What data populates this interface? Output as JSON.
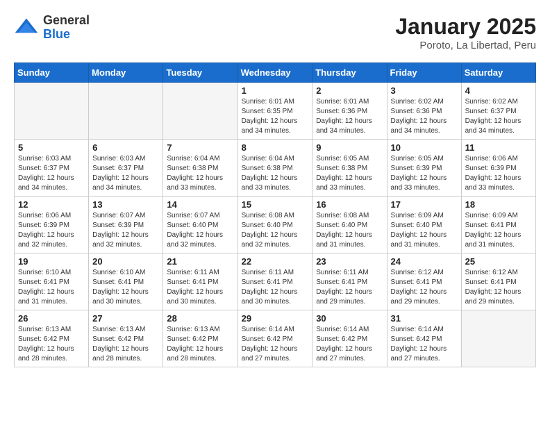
{
  "header": {
    "logo": {
      "general": "General",
      "blue": "Blue"
    },
    "title": "January 2025",
    "location": "Poroto, La Libertad, Peru"
  },
  "calendar": {
    "weekdays": [
      "Sunday",
      "Monday",
      "Tuesday",
      "Wednesday",
      "Thursday",
      "Friday",
      "Saturday"
    ],
    "weeks": [
      [
        {
          "day": "",
          "info": ""
        },
        {
          "day": "",
          "info": ""
        },
        {
          "day": "",
          "info": ""
        },
        {
          "day": "1",
          "info": "Sunrise: 6:01 AM\nSunset: 6:35 PM\nDaylight: 12 hours\nand 34 minutes."
        },
        {
          "day": "2",
          "info": "Sunrise: 6:01 AM\nSunset: 6:36 PM\nDaylight: 12 hours\nand 34 minutes."
        },
        {
          "day": "3",
          "info": "Sunrise: 6:02 AM\nSunset: 6:36 PM\nDaylight: 12 hours\nand 34 minutes."
        },
        {
          "day": "4",
          "info": "Sunrise: 6:02 AM\nSunset: 6:37 PM\nDaylight: 12 hours\nand 34 minutes."
        }
      ],
      [
        {
          "day": "5",
          "info": "Sunrise: 6:03 AM\nSunset: 6:37 PM\nDaylight: 12 hours\nand 34 minutes."
        },
        {
          "day": "6",
          "info": "Sunrise: 6:03 AM\nSunset: 6:37 PM\nDaylight: 12 hours\nand 34 minutes."
        },
        {
          "day": "7",
          "info": "Sunrise: 6:04 AM\nSunset: 6:38 PM\nDaylight: 12 hours\nand 33 minutes."
        },
        {
          "day": "8",
          "info": "Sunrise: 6:04 AM\nSunset: 6:38 PM\nDaylight: 12 hours\nand 33 minutes."
        },
        {
          "day": "9",
          "info": "Sunrise: 6:05 AM\nSunset: 6:38 PM\nDaylight: 12 hours\nand 33 minutes."
        },
        {
          "day": "10",
          "info": "Sunrise: 6:05 AM\nSunset: 6:39 PM\nDaylight: 12 hours\nand 33 minutes."
        },
        {
          "day": "11",
          "info": "Sunrise: 6:06 AM\nSunset: 6:39 PM\nDaylight: 12 hours\nand 33 minutes."
        }
      ],
      [
        {
          "day": "12",
          "info": "Sunrise: 6:06 AM\nSunset: 6:39 PM\nDaylight: 12 hours\nand 32 minutes."
        },
        {
          "day": "13",
          "info": "Sunrise: 6:07 AM\nSunset: 6:39 PM\nDaylight: 12 hours\nand 32 minutes."
        },
        {
          "day": "14",
          "info": "Sunrise: 6:07 AM\nSunset: 6:40 PM\nDaylight: 12 hours\nand 32 minutes."
        },
        {
          "day": "15",
          "info": "Sunrise: 6:08 AM\nSunset: 6:40 PM\nDaylight: 12 hours\nand 32 minutes."
        },
        {
          "day": "16",
          "info": "Sunrise: 6:08 AM\nSunset: 6:40 PM\nDaylight: 12 hours\nand 31 minutes."
        },
        {
          "day": "17",
          "info": "Sunrise: 6:09 AM\nSunset: 6:40 PM\nDaylight: 12 hours\nand 31 minutes."
        },
        {
          "day": "18",
          "info": "Sunrise: 6:09 AM\nSunset: 6:41 PM\nDaylight: 12 hours\nand 31 minutes."
        }
      ],
      [
        {
          "day": "19",
          "info": "Sunrise: 6:10 AM\nSunset: 6:41 PM\nDaylight: 12 hours\nand 31 minutes."
        },
        {
          "day": "20",
          "info": "Sunrise: 6:10 AM\nSunset: 6:41 PM\nDaylight: 12 hours\nand 30 minutes."
        },
        {
          "day": "21",
          "info": "Sunrise: 6:11 AM\nSunset: 6:41 PM\nDaylight: 12 hours\nand 30 minutes."
        },
        {
          "day": "22",
          "info": "Sunrise: 6:11 AM\nSunset: 6:41 PM\nDaylight: 12 hours\nand 30 minutes."
        },
        {
          "day": "23",
          "info": "Sunrise: 6:11 AM\nSunset: 6:41 PM\nDaylight: 12 hours\nand 29 minutes."
        },
        {
          "day": "24",
          "info": "Sunrise: 6:12 AM\nSunset: 6:41 PM\nDaylight: 12 hours\nand 29 minutes."
        },
        {
          "day": "25",
          "info": "Sunrise: 6:12 AM\nSunset: 6:41 PM\nDaylight: 12 hours\nand 29 minutes."
        }
      ],
      [
        {
          "day": "26",
          "info": "Sunrise: 6:13 AM\nSunset: 6:42 PM\nDaylight: 12 hours\nand 28 minutes."
        },
        {
          "day": "27",
          "info": "Sunrise: 6:13 AM\nSunset: 6:42 PM\nDaylight: 12 hours\nand 28 minutes."
        },
        {
          "day": "28",
          "info": "Sunrise: 6:13 AM\nSunset: 6:42 PM\nDaylight: 12 hours\nand 28 minutes."
        },
        {
          "day": "29",
          "info": "Sunrise: 6:14 AM\nSunset: 6:42 PM\nDaylight: 12 hours\nand 27 minutes."
        },
        {
          "day": "30",
          "info": "Sunrise: 6:14 AM\nSunset: 6:42 PM\nDaylight: 12 hours\nand 27 minutes."
        },
        {
          "day": "31",
          "info": "Sunrise: 6:14 AM\nSunset: 6:42 PM\nDaylight: 12 hours\nand 27 minutes."
        },
        {
          "day": "",
          "info": ""
        }
      ]
    ]
  }
}
